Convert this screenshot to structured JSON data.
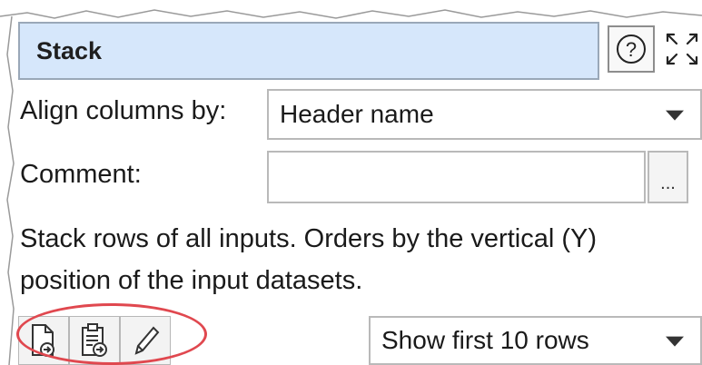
{
  "panel": {
    "title": "Stack",
    "help_icon": "question-circle-icon",
    "maximize_icon": "expand-arrows-icon"
  },
  "align": {
    "label": "Align columns by:",
    "selected": "Header name"
  },
  "comment": {
    "label": "Comment:",
    "value": "",
    "ellipsis": "..."
  },
  "description": "Stack rows of all inputs. Orders by the vertical (Y) position of the input datasets.",
  "toolbar": {
    "buttons": [
      {
        "icon": "document-arrow-icon"
      },
      {
        "icon": "clipboard-arrow-icon"
      },
      {
        "icon": "pencil-icon"
      }
    ],
    "rows_select": "Show first 10 rows"
  },
  "colors": {
    "title_bg": "#d6e7fb",
    "highlight": "#e0484f"
  }
}
